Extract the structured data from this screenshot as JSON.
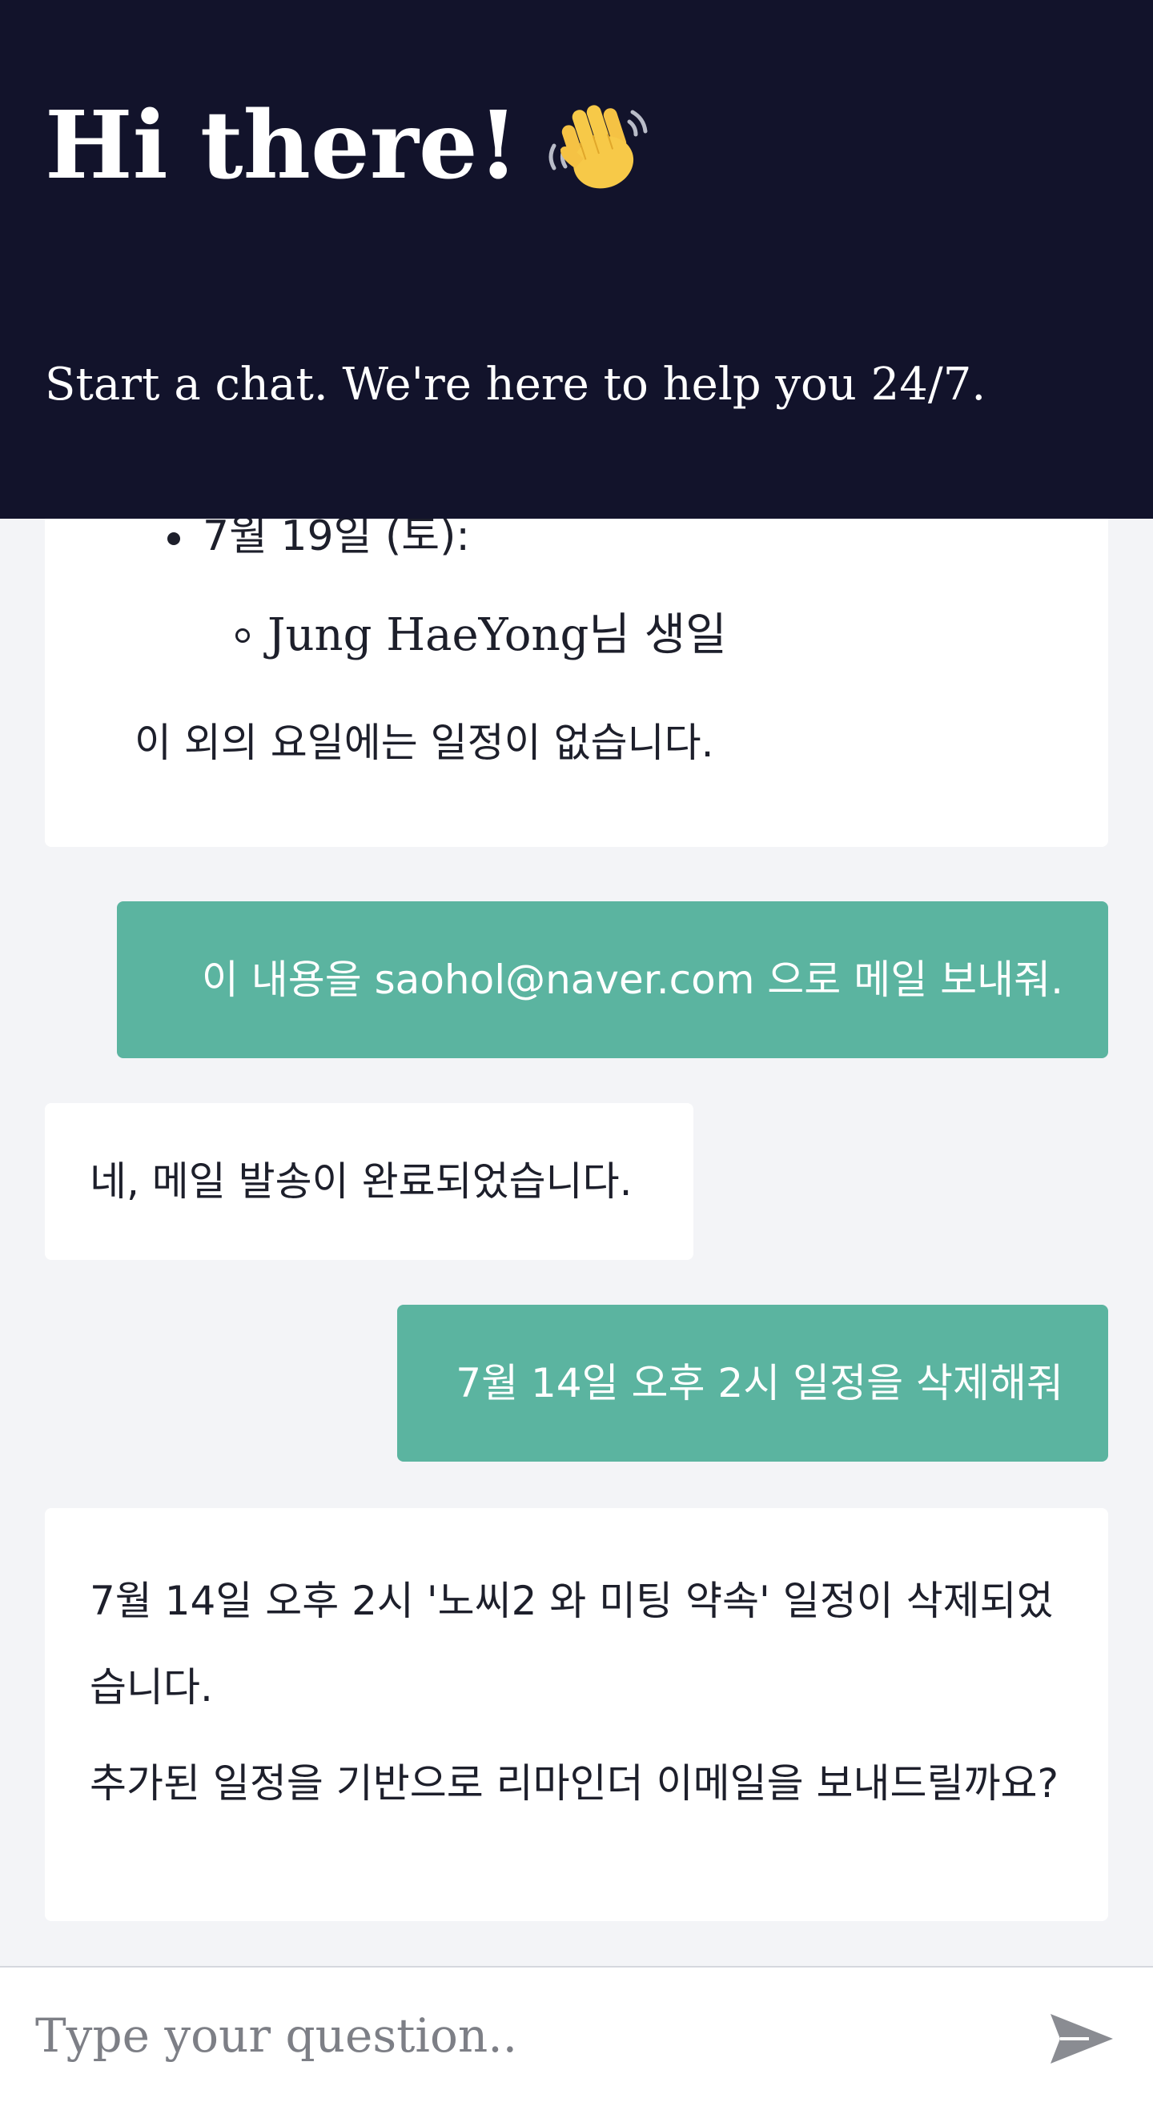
{
  "header": {
    "title": "Hi there!",
    "wave_icon": "waving-hand-icon",
    "subtitle": "Start a chat. We're here to help you 24/7."
  },
  "messages": [
    {
      "role": "bot",
      "list_item": "7월 19일 (토):",
      "sub_item": "Jung HaeYong님 생일",
      "note": "이 외의 요일에는 일정이 없습니다."
    },
    {
      "role": "user",
      "text": "이 내용을 saohol@naver.com 으로 메일 보내줘."
    },
    {
      "role": "bot",
      "text": "네, 메일 발송이 완료되었습니다."
    },
    {
      "role": "user",
      "text": "7월 14일 오후 2시 일정을 삭제해줘"
    },
    {
      "role": "bot",
      "paragraph1": "7월 14일 오후 2시 '노씨2 와 미팅 약속' 일정이 삭제되었습니다.",
      "paragraph2": "추가된 일정을 기반으로 리마인더 이메일을 보내드릴까요?"
    }
  ],
  "input": {
    "placeholder": "Type your question..",
    "value": ""
  },
  "send_icon": "send-icon",
  "colors": {
    "header_bg": "#12132b",
    "user_bubble": "#5bb4a0",
    "page_bg": "#f3f4f7"
  }
}
